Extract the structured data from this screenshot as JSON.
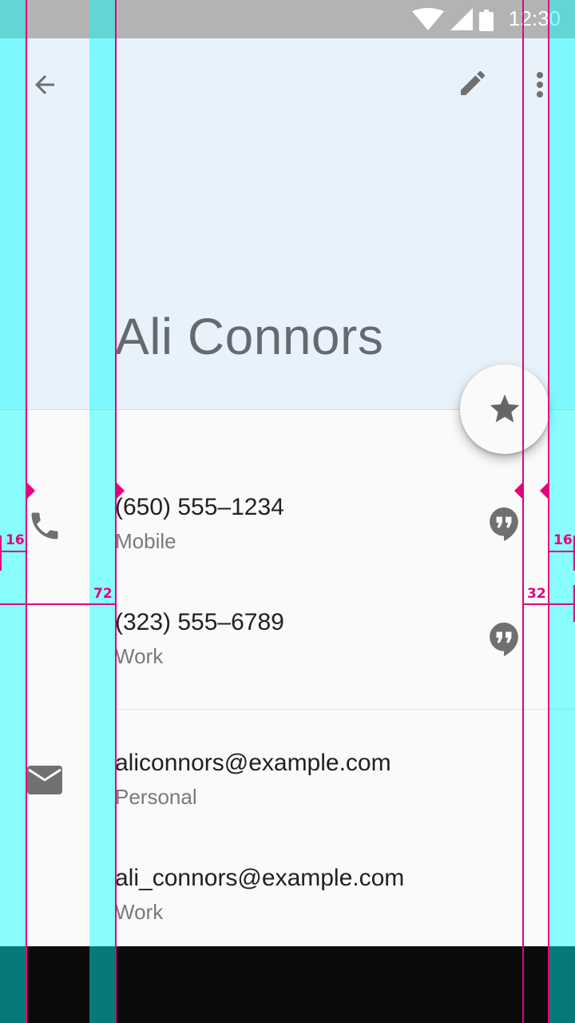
{
  "status_bar": {
    "time": "12:30",
    "icons": [
      "wifi-icon",
      "cell-signal-icon",
      "battery-icon"
    ]
  },
  "header": {
    "contact_name": "Ali Connors",
    "actions": [
      "back-arrow-icon",
      "edit-pencil-icon",
      "more-vert-icon"
    ]
  },
  "fab": {
    "icon": "star-icon"
  },
  "phones": [
    {
      "number": "(650) 555–1234",
      "type": "Mobile"
    },
    {
      "number": "(323) 555–6789",
      "type": "Work"
    }
  ],
  "emails": [
    {
      "address": "aliconnors@example.com",
      "type": "Personal"
    },
    {
      "address": "ali_connors@example.com",
      "type": "Work"
    }
  ],
  "keylines": {
    "left_margin": "16",
    "content_inset": "72",
    "right_margin": "16",
    "action_inset": "32"
  },
  "colors": {
    "header_bg": "#e8f2fb",
    "keyline": "#e6007e",
    "keyline_band": "#00ffff",
    "icon": "#707070",
    "nav_bar": "#0b0b0b"
  }
}
